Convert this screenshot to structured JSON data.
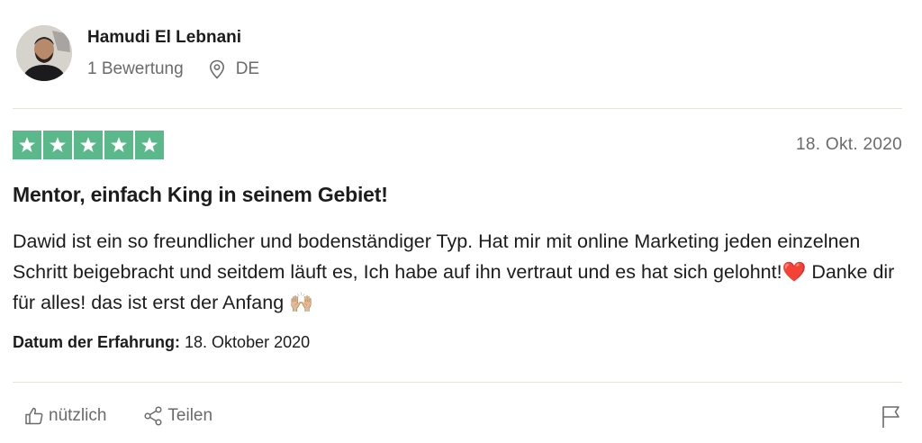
{
  "reviewer": {
    "name": "Hamudi El Lebnani",
    "review_count": "1 Bewertung",
    "location": "DE"
  },
  "review": {
    "rating": 5,
    "star_color": "#5ab88a",
    "date": "18. Okt. 2020",
    "title": "Mentor, einfach King in seinem Gebiet!",
    "body_text": "Dawid ist ein so freundlicher und bodenständiger Typ. Hat mir mit online Marketing jeden einzelnen Schritt beigebracht und seitdem läuft es, Ich habe auf ihn vertraut und es hat sich gelohnt!",
    "body_emoji_heart": "❤️",
    "body_text_2": " Danke dir für alles! das ist erst der Anfang ",
    "body_emoji_hands": "🙌🏼",
    "experience_label": "Datum der Erfahrung:",
    "experience_date": "18. Oktober 2020"
  },
  "actions": {
    "helpful_label": "nützlich",
    "share_label": "Teilen"
  },
  "icons": {
    "location": "location-pin-icon",
    "helpful": "thumbs-up-icon",
    "share": "share-icon",
    "report": "flag-icon",
    "star": "star-icon"
  }
}
